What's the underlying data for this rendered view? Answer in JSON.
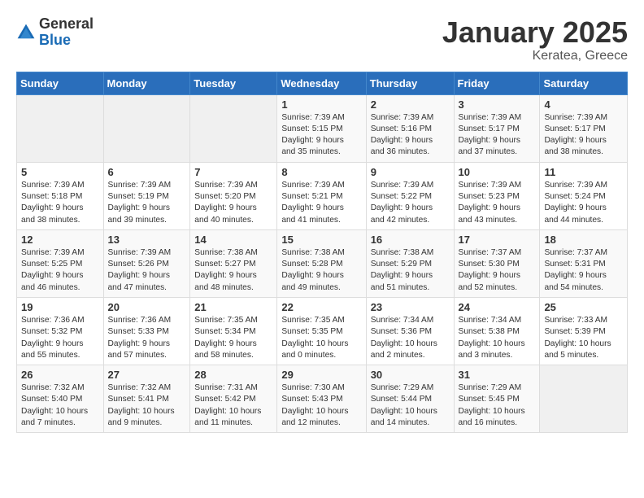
{
  "logo": {
    "general": "General",
    "blue": "Blue"
  },
  "title": "January 2025",
  "subtitle": "Keratea, Greece",
  "days_of_week": [
    "Sunday",
    "Monday",
    "Tuesday",
    "Wednesday",
    "Thursday",
    "Friday",
    "Saturday"
  ],
  "weeks": [
    [
      {
        "day": "",
        "content": ""
      },
      {
        "day": "",
        "content": ""
      },
      {
        "day": "",
        "content": ""
      },
      {
        "day": "1",
        "content": "Sunrise: 7:39 AM\nSunset: 5:15 PM\nDaylight: 9 hours\nand 35 minutes."
      },
      {
        "day": "2",
        "content": "Sunrise: 7:39 AM\nSunset: 5:16 PM\nDaylight: 9 hours\nand 36 minutes."
      },
      {
        "day": "3",
        "content": "Sunrise: 7:39 AM\nSunset: 5:17 PM\nDaylight: 9 hours\nand 37 minutes."
      },
      {
        "day": "4",
        "content": "Sunrise: 7:39 AM\nSunset: 5:17 PM\nDaylight: 9 hours\nand 38 minutes."
      }
    ],
    [
      {
        "day": "5",
        "content": "Sunrise: 7:39 AM\nSunset: 5:18 PM\nDaylight: 9 hours\nand 38 minutes."
      },
      {
        "day": "6",
        "content": "Sunrise: 7:39 AM\nSunset: 5:19 PM\nDaylight: 9 hours\nand 39 minutes."
      },
      {
        "day": "7",
        "content": "Sunrise: 7:39 AM\nSunset: 5:20 PM\nDaylight: 9 hours\nand 40 minutes."
      },
      {
        "day": "8",
        "content": "Sunrise: 7:39 AM\nSunset: 5:21 PM\nDaylight: 9 hours\nand 41 minutes."
      },
      {
        "day": "9",
        "content": "Sunrise: 7:39 AM\nSunset: 5:22 PM\nDaylight: 9 hours\nand 42 minutes."
      },
      {
        "day": "10",
        "content": "Sunrise: 7:39 AM\nSunset: 5:23 PM\nDaylight: 9 hours\nand 43 minutes."
      },
      {
        "day": "11",
        "content": "Sunrise: 7:39 AM\nSunset: 5:24 PM\nDaylight: 9 hours\nand 44 minutes."
      }
    ],
    [
      {
        "day": "12",
        "content": "Sunrise: 7:39 AM\nSunset: 5:25 PM\nDaylight: 9 hours\nand 46 minutes."
      },
      {
        "day": "13",
        "content": "Sunrise: 7:39 AM\nSunset: 5:26 PM\nDaylight: 9 hours\nand 47 minutes."
      },
      {
        "day": "14",
        "content": "Sunrise: 7:38 AM\nSunset: 5:27 PM\nDaylight: 9 hours\nand 48 minutes."
      },
      {
        "day": "15",
        "content": "Sunrise: 7:38 AM\nSunset: 5:28 PM\nDaylight: 9 hours\nand 49 minutes."
      },
      {
        "day": "16",
        "content": "Sunrise: 7:38 AM\nSunset: 5:29 PM\nDaylight: 9 hours\nand 51 minutes."
      },
      {
        "day": "17",
        "content": "Sunrise: 7:37 AM\nSunset: 5:30 PM\nDaylight: 9 hours\nand 52 minutes."
      },
      {
        "day": "18",
        "content": "Sunrise: 7:37 AM\nSunset: 5:31 PM\nDaylight: 9 hours\nand 54 minutes."
      }
    ],
    [
      {
        "day": "19",
        "content": "Sunrise: 7:36 AM\nSunset: 5:32 PM\nDaylight: 9 hours\nand 55 minutes."
      },
      {
        "day": "20",
        "content": "Sunrise: 7:36 AM\nSunset: 5:33 PM\nDaylight: 9 hours\nand 57 minutes."
      },
      {
        "day": "21",
        "content": "Sunrise: 7:35 AM\nSunset: 5:34 PM\nDaylight: 9 hours\nand 58 minutes."
      },
      {
        "day": "22",
        "content": "Sunrise: 7:35 AM\nSunset: 5:35 PM\nDaylight: 10 hours\nand 0 minutes."
      },
      {
        "day": "23",
        "content": "Sunrise: 7:34 AM\nSunset: 5:36 PM\nDaylight: 10 hours\nand 2 minutes."
      },
      {
        "day": "24",
        "content": "Sunrise: 7:34 AM\nSunset: 5:38 PM\nDaylight: 10 hours\nand 3 minutes."
      },
      {
        "day": "25",
        "content": "Sunrise: 7:33 AM\nSunset: 5:39 PM\nDaylight: 10 hours\nand 5 minutes."
      }
    ],
    [
      {
        "day": "26",
        "content": "Sunrise: 7:32 AM\nSunset: 5:40 PM\nDaylight: 10 hours\nand 7 minutes."
      },
      {
        "day": "27",
        "content": "Sunrise: 7:32 AM\nSunset: 5:41 PM\nDaylight: 10 hours\nand 9 minutes."
      },
      {
        "day": "28",
        "content": "Sunrise: 7:31 AM\nSunset: 5:42 PM\nDaylight: 10 hours\nand 11 minutes."
      },
      {
        "day": "29",
        "content": "Sunrise: 7:30 AM\nSunset: 5:43 PM\nDaylight: 10 hours\nand 12 minutes."
      },
      {
        "day": "30",
        "content": "Sunrise: 7:29 AM\nSunset: 5:44 PM\nDaylight: 10 hours\nand 14 minutes."
      },
      {
        "day": "31",
        "content": "Sunrise: 7:29 AM\nSunset: 5:45 PM\nDaylight: 10 hours\nand 16 minutes."
      },
      {
        "day": "",
        "content": ""
      }
    ]
  ]
}
